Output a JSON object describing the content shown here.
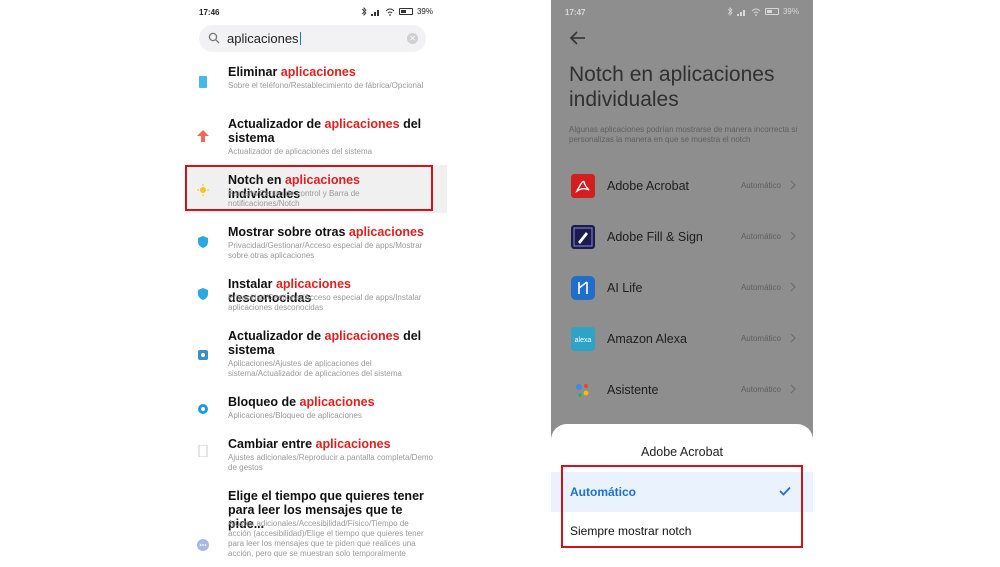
{
  "left": {
    "status": {
      "time": "17:46",
      "battery": "39%"
    },
    "search": {
      "query": "aplicaciones"
    },
    "results": [
      {
        "title_pre": "Eliminar ",
        "title_hl": "aplicaciones",
        "title_post": "",
        "sub": "Sobre el teléfono/Restablecimiento de fábrica/Opcional",
        "icon": "phone-icon",
        "color": "#46b8e8"
      },
      {
        "title_pre": "Actualizador de ",
        "title_hl": "aplicaciones",
        "title_post": " del sistema",
        "sub": "Actualizador de aplicaciones del sistema",
        "icon": "arrow-up-icon",
        "color": "#f06a5a"
      },
      {
        "title_pre": "Notch en ",
        "title_hl": "aplicaciones",
        "title_post": " individuales",
        "sub": "Pantalla/Centro de control y Barra de notificaciones/Notch",
        "icon": "sun-icon",
        "color": "#f5c518"
      },
      {
        "title_pre": "Mostrar sobre otras ",
        "title_hl": "aplicaciones",
        "title_post": "",
        "sub": "Privacidad/Gestionar/Acceso especial de apps/Mostrar sobre otras aplicaciones",
        "icon": "shield-icon",
        "color": "#2ba8e0"
      },
      {
        "title_pre": "Instalar ",
        "title_hl": "aplicaciones",
        "title_post": " desconocidas",
        "sub": "Privacidad/Gestionar/Acceso especial de apps/Instalar aplicaciones desconocidas",
        "icon": "shield-icon",
        "color": "#2ba8e0"
      },
      {
        "title_pre": "Actualizador de ",
        "title_hl": "aplicaciones",
        "title_post": " del sistema",
        "sub": "Aplicaciones/Ajustes de aplicaciones del sistema/Actualizador de aplicaciones del sistema",
        "icon": "settings-square-icon",
        "color": "#3a8fc4"
      },
      {
        "title_pre": "Bloqueo de ",
        "title_hl": "aplicaciones",
        "title_post": "",
        "sub": "Aplicaciones/Bloqueo de aplicaciones",
        "icon": "gear-icon",
        "color": "#1e9be0"
      },
      {
        "title_pre": "Cambiar entre ",
        "title_hl": "aplicaciones",
        "title_post": "",
        "sub": "Ajustes adicionales/Reproducir a pantalla completa/Demo de gestos",
        "icon": "fullscreen-icon",
        "color": "#cccccc"
      },
      {
        "title_pre": "Elige el tiempo que quieres tener para leer los mensajes que te pide...",
        "title_hl": "",
        "title_post": "",
        "sub": "Ajustes adicionales/Accesibilidad/Físico/Tiempo de acción (accesibilidad)/Elige el tiempo que quieres tener para leer los mensajes que te piden que realices una acción, pero que se muestran solo temporalmente",
        "icon": "dots-icon",
        "color": "#a9b9e6"
      }
    ]
  },
  "right": {
    "status": {
      "time": "17:47",
      "battery": "39%"
    },
    "title": "Notch en aplicaciones individuales",
    "description": "Algunas aplicaciones podrían mostrarse de manera incorrecta si personalizas la manera en que se muestra el notch",
    "apps": [
      {
        "name": "Adobe Acrobat",
        "mode": "Automático",
        "icon": "adobe-acrobat-icon",
        "color": "#d21e1e"
      },
      {
        "name": "Adobe Fill & Sign",
        "mode": "Automático",
        "icon": "adobe-fill-sign-icon",
        "color": "#1c1b4f"
      },
      {
        "name": "AI Life",
        "mode": "Automático",
        "icon": "ai-life-icon",
        "color": "#1f6fc9"
      },
      {
        "name": "Amazon Alexa",
        "mode": "Automático",
        "icon": "alexa-icon",
        "color": "#2fa3c5"
      },
      {
        "name": "Asistente",
        "mode": "Automático",
        "icon": "assistant-icon",
        "color": "#4285f4"
      }
    ],
    "sheet": {
      "title": "Adobe Acrobat",
      "options": [
        {
          "label": "Automático",
          "selected": true
        },
        {
          "label": "Siempre mostrar notch",
          "selected": false
        }
      ]
    },
    "accent": "#1e6fd6"
  },
  "highlight_color": "#d0141c"
}
